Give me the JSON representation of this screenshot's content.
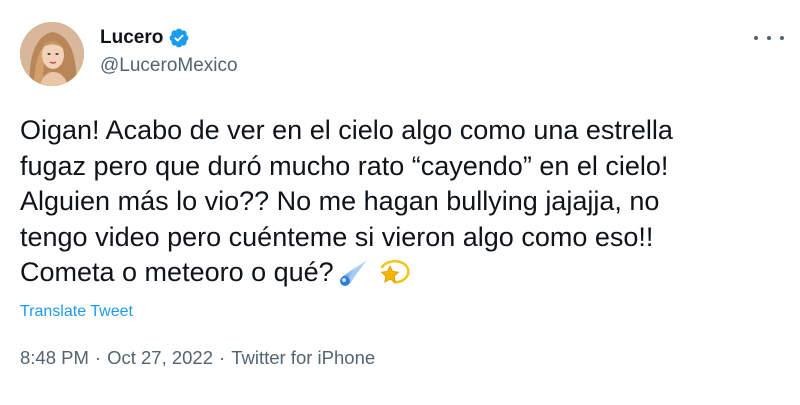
{
  "author": {
    "display_name": "Lucero",
    "handle": "@LuceroMexico",
    "verified": true,
    "avatar_icon": "profile-photo"
  },
  "tweet": {
    "lines": [
      "Oigan! Acabo de ver en el cielo algo como una estrella",
      "fugaz pero que duró mucho rato “cayendo” en el cielo!",
      "Alguien más lo vio?? No me hagan bullying jajajja, no",
      "tengo video pero cuénteme si vieron algo como eso!!",
      "Cometa o meteoro o qué?"
    ],
    "emojis": [
      "comet-emoji",
      "dizzy-star-emoji"
    ]
  },
  "translate_label": "Translate Tweet",
  "meta": {
    "time": "8:48 PM",
    "separator": "·",
    "date": "Oct 27, 2022",
    "source": "Twitter for iPhone"
  },
  "colors": {
    "link": "#1d9bf0",
    "secondary_text": "#536471",
    "primary_text": "#0f1419",
    "verified_badge": "#1d9bf0"
  }
}
